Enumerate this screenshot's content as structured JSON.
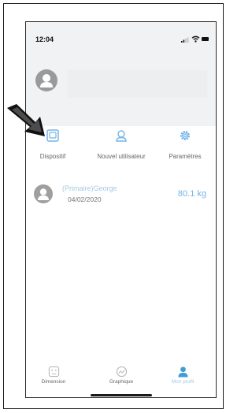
{
  "status_bar": {
    "time": "12:04"
  },
  "actions": [
    {
      "label": "Dispositif",
      "icon": "device-icon"
    },
    {
      "label": "Nouvel utilisateur",
      "icon": "add-user-icon"
    },
    {
      "label": "Paramètres",
      "icon": "gear-icon"
    }
  ],
  "users": [
    {
      "name": "(Primaire)George",
      "date": "04/02/2020",
      "weight": "80.1 kg"
    }
  ],
  "tabs": [
    {
      "label": "Dimension",
      "icon": "dimension-icon",
      "active": false
    },
    {
      "label": "Graphique",
      "icon": "chart-icon",
      "active": false
    },
    {
      "label": "Mon profil",
      "icon": "profile-icon",
      "active": true
    }
  ],
  "colors": {
    "accent": "#74b3e8",
    "accent_light": "#a5c9e5",
    "header_bg": "#f1f2f4",
    "pointer": "#111111"
  }
}
